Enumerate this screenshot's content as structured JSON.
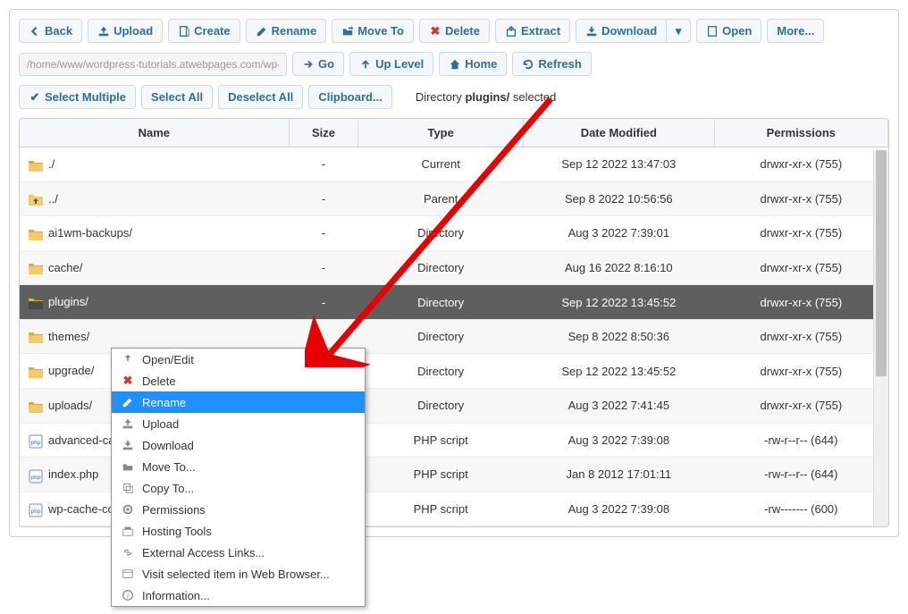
{
  "toolbar": {
    "back": "Back",
    "upload": "Upload",
    "create": "Create",
    "rename": "Rename",
    "move_to": "Move To",
    "delete": "Delete",
    "extract": "Extract",
    "download": "Download",
    "open": "Open",
    "more": "More..."
  },
  "navbar": {
    "path": "/home/www/wordpress-tutorials.atwebpages.com/wp-con",
    "go": "Go",
    "up_level": "Up Level",
    "home": "Home",
    "refresh": "Refresh"
  },
  "selectbar": {
    "select_multiple": "Select Multiple",
    "select_all": "Select All",
    "deselect_all": "Deselect All",
    "clipboard": "Clipboard...",
    "status_prefix": "Directory ",
    "status_bold": "plugins/",
    "status_suffix": " selected"
  },
  "columns": {
    "name": "Name",
    "size": "Size",
    "type": "Type",
    "date": "Date Modified",
    "perms": "Permissions"
  },
  "rows": [
    {
      "icon": "folder",
      "name": "./",
      "size": "-",
      "type": "Current",
      "date": "Sep 12 2022 13:47:03",
      "perms": "drwxr-xr-x (755)",
      "selected": false
    },
    {
      "icon": "folder-up",
      "name": "../",
      "size": "-",
      "type": "Parent",
      "date": "Sep 8 2022 10:56:56",
      "perms": "drwxr-xr-x (755)",
      "selected": false
    },
    {
      "icon": "folder",
      "name": "ai1wm-backups/",
      "size": "-",
      "type": "Directory",
      "date": "Aug 3 2022 7:39:01",
      "perms": "drwxr-xr-x (755)",
      "selected": false
    },
    {
      "icon": "folder",
      "name": "cache/",
      "size": "-",
      "type": "Directory",
      "date": "Aug 16 2022 8:16:10",
      "perms": "drwxr-xr-x (755)",
      "selected": false
    },
    {
      "icon": "folder",
      "name": "plugins/",
      "size": "-",
      "type": "Directory",
      "date": "Sep 12 2022 13:45:52",
      "perms": "drwxr-xr-x (755)",
      "selected": true
    },
    {
      "icon": "folder",
      "name": "themes/",
      "size": "",
      "type": "Directory",
      "date": "Sep 8 2022 8:50:36",
      "perms": "drwxr-xr-x (755)",
      "selected": false
    },
    {
      "icon": "folder",
      "name": "upgrade/",
      "size": "",
      "type": "Directory",
      "date": "Sep 12 2022 13:45:52",
      "perms": "drwxr-xr-x (755)",
      "selected": false
    },
    {
      "icon": "folder",
      "name": "uploads/",
      "size": "",
      "type": "Directory",
      "date": "Aug 3 2022 7:41:45",
      "perms": "drwxr-xr-x (755)",
      "selected": false
    },
    {
      "icon": "php",
      "name": "advanced-ca",
      "size": "",
      "type": "PHP script",
      "date": "Aug 3 2022 7:39:08",
      "perms": "-rw-r--r-- (644)",
      "selected": false
    },
    {
      "icon": "php",
      "name": "index.php",
      "size": "",
      "type": "PHP script",
      "date": "Jan 8 2012 17:01:11",
      "perms": "-rw-r--r-- (644)",
      "selected": false
    },
    {
      "icon": "php",
      "name": "wp-cache-co",
      "size": "",
      "type": "PHP script",
      "date": "Aug 3 2022 7:39:08",
      "perms": "-rw------- (600)",
      "selected": false
    }
  ],
  "context_menu": [
    {
      "icon": "open",
      "label": "Open/Edit"
    },
    {
      "icon": "delete",
      "label": "Delete"
    },
    {
      "icon": "rename",
      "label": "Rename",
      "highlighted": true
    },
    {
      "icon": "upload",
      "label": "Upload"
    },
    {
      "icon": "download",
      "label": "Download"
    },
    {
      "icon": "moveto",
      "label": "Move To..."
    },
    {
      "icon": "copyto",
      "label": "Copy To..."
    },
    {
      "icon": "perms",
      "label": "Permissions"
    },
    {
      "icon": "tools",
      "label": "Hosting Tools"
    },
    {
      "icon": "links",
      "label": "External Access Links..."
    },
    {
      "icon": "browser",
      "label": "Visit selected item in Web Browser..."
    },
    {
      "icon": "info",
      "label": "Information..."
    }
  ]
}
